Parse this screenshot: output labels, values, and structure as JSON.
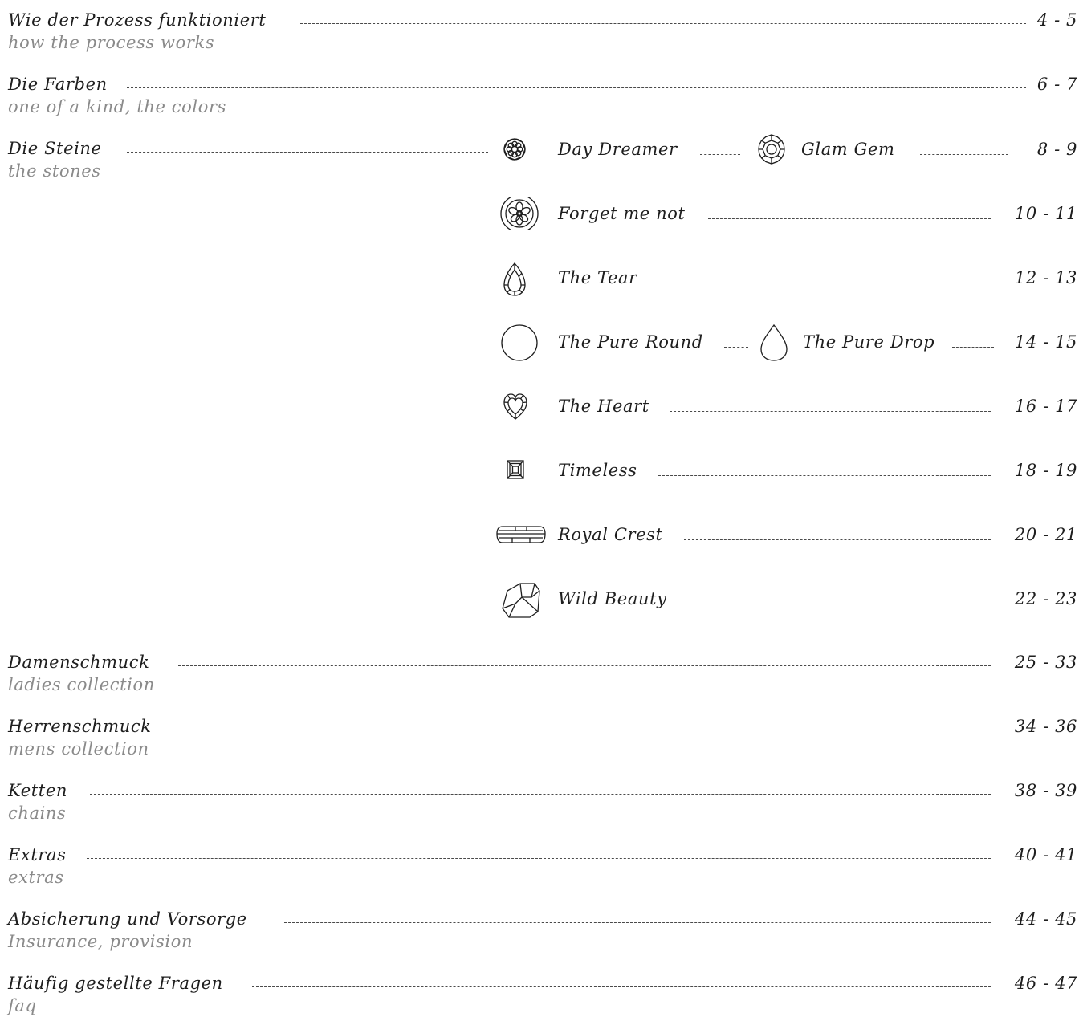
{
  "toc": {
    "sections": [
      {
        "title": "Wie der Prozess funktioniert",
        "subtitle": "how the process works",
        "pages": "4 - 5"
      },
      {
        "title": "Die Farben",
        "subtitle": "one of a kind, the colors",
        "pages": "6 - 7"
      },
      {
        "title": "Die Steine",
        "subtitle": "the stones"
      },
      {
        "title": "Damenschmuck",
        "subtitle": "ladies collection",
        "pages": "25 - 33"
      },
      {
        "title": "Herrenschmuck",
        "subtitle": "mens collection",
        "pages": "34 - 36"
      },
      {
        "title": "Ketten",
        "subtitle": "chains",
        "pages": "38 - 39"
      },
      {
        "title": "Extras",
        "subtitle": "extras",
        "pages": "40 - 41"
      },
      {
        "title": "Absicherung und Vorsorge",
        "subtitle": "Insurance, provision",
        "pages": "44 - 45"
      },
      {
        "title": "Häufig gestellte Fragen",
        "subtitle": "faq",
        "pages": "46 - 47"
      }
    ],
    "stones": [
      {
        "name": "Day Dreamer",
        "name2": "Glam Gem",
        "pages": "8 - 9",
        "icon": "day-dreamer-icon",
        "icon2": "glam-gem-icon"
      },
      {
        "name": "Forget me not",
        "pages": "10 - 11",
        "icon": "forget-me-not-icon"
      },
      {
        "name": "The Tear",
        "pages": "12 - 13",
        "icon": "tear-icon"
      },
      {
        "name": "The Pure Round",
        "name2": "The Pure Drop",
        "pages": "14 - 15",
        "icon": "pure-round-icon",
        "icon2": "pure-drop-icon"
      },
      {
        "name": "The Heart",
        "pages": "16 - 17",
        "icon": "heart-icon"
      },
      {
        "name": "Timeless",
        "pages": "18 - 19",
        "icon": "timeless-icon"
      },
      {
        "name": "Royal Crest",
        "pages": "20 - 21",
        "icon": "royal-crest-icon"
      },
      {
        "name": "Wild Beauty",
        "pages": "22 - 23",
        "icon": "wild-beauty-icon"
      }
    ]
  },
  "colors": {
    "text": "#1e1e1e",
    "subtitle": "#8a8a8a",
    "leader": "#4a4a4a"
  }
}
